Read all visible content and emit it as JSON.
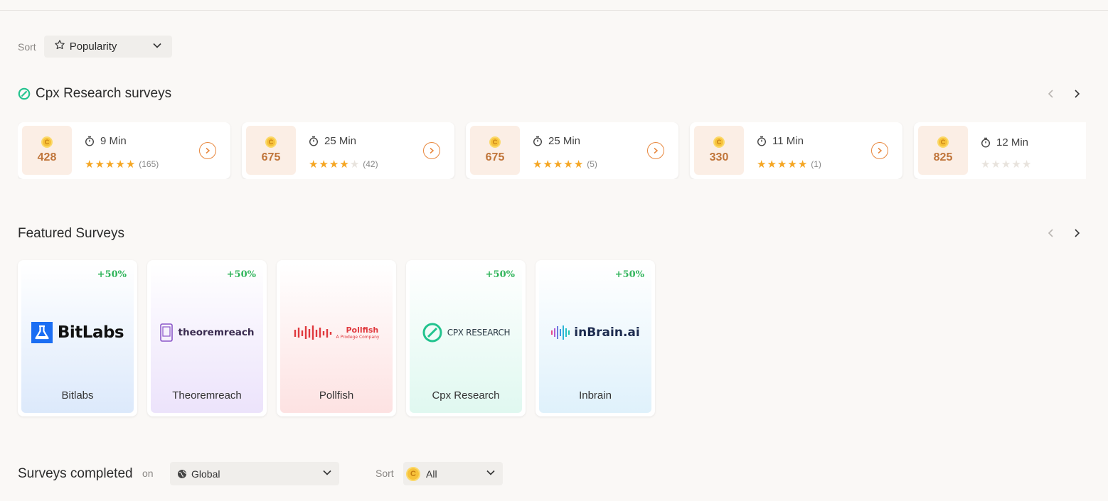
{
  "sort": {
    "label": "Sort",
    "value": "Popularity"
  },
  "cpx_section": {
    "title": "Cpx Research surveys"
  },
  "surveys": [
    {
      "reward": "428",
      "time": "9 Min",
      "rating": 5,
      "count": "(165)"
    },
    {
      "reward": "675",
      "time": "25 Min",
      "rating": 4,
      "count": "(42)"
    },
    {
      "reward": "675",
      "time": "25 Min",
      "rating": 5,
      "count": "(5)"
    },
    {
      "reward": "330",
      "time": "11 Min",
      "rating": 5,
      "count": "(1)"
    },
    {
      "reward": "825",
      "time": "12 Min",
      "rating": 0,
      "count": ""
    }
  ],
  "featured": {
    "title": "Featured Surveys",
    "items": [
      {
        "name": "Bitlabs",
        "bonus": "+50%",
        "logo_text": "BitLabs",
        "bg_top": "#ffffff",
        "bg_bottom": "#dce9fb"
      },
      {
        "name": "Theoremreach",
        "bonus": "+50%",
        "logo_text": "theoremreach",
        "bg_top": "#ffffff",
        "bg_bottom": "#ece3fb"
      },
      {
        "name": "Pollfish",
        "bonus": "",
        "logo_text": "Pollfish",
        "logo_sub": "A Prodege Company",
        "bg_top": "#ffffff",
        "bg_bottom": "#fde2e2"
      },
      {
        "name": "Cpx Research",
        "bonus": "+50%",
        "logo_text": "CPX RESEARCH",
        "bg_top": "#ffffff",
        "bg_bottom": "#e0f8f0"
      },
      {
        "name": "Inbrain",
        "bonus": "+50%",
        "logo_text": "inBrain.ai",
        "bg_top": "#ffffff",
        "bg_bottom": "#dff1fb"
      }
    ]
  },
  "completed": {
    "title": "Surveys completed",
    "on_label": "on",
    "region": "Global",
    "sort_label": "Sort",
    "filter": "All"
  },
  "colors": {
    "accent": "#e8873d",
    "star": "#f5a623",
    "bonus": "#2fb45a",
    "cpx": "#22c38e"
  }
}
